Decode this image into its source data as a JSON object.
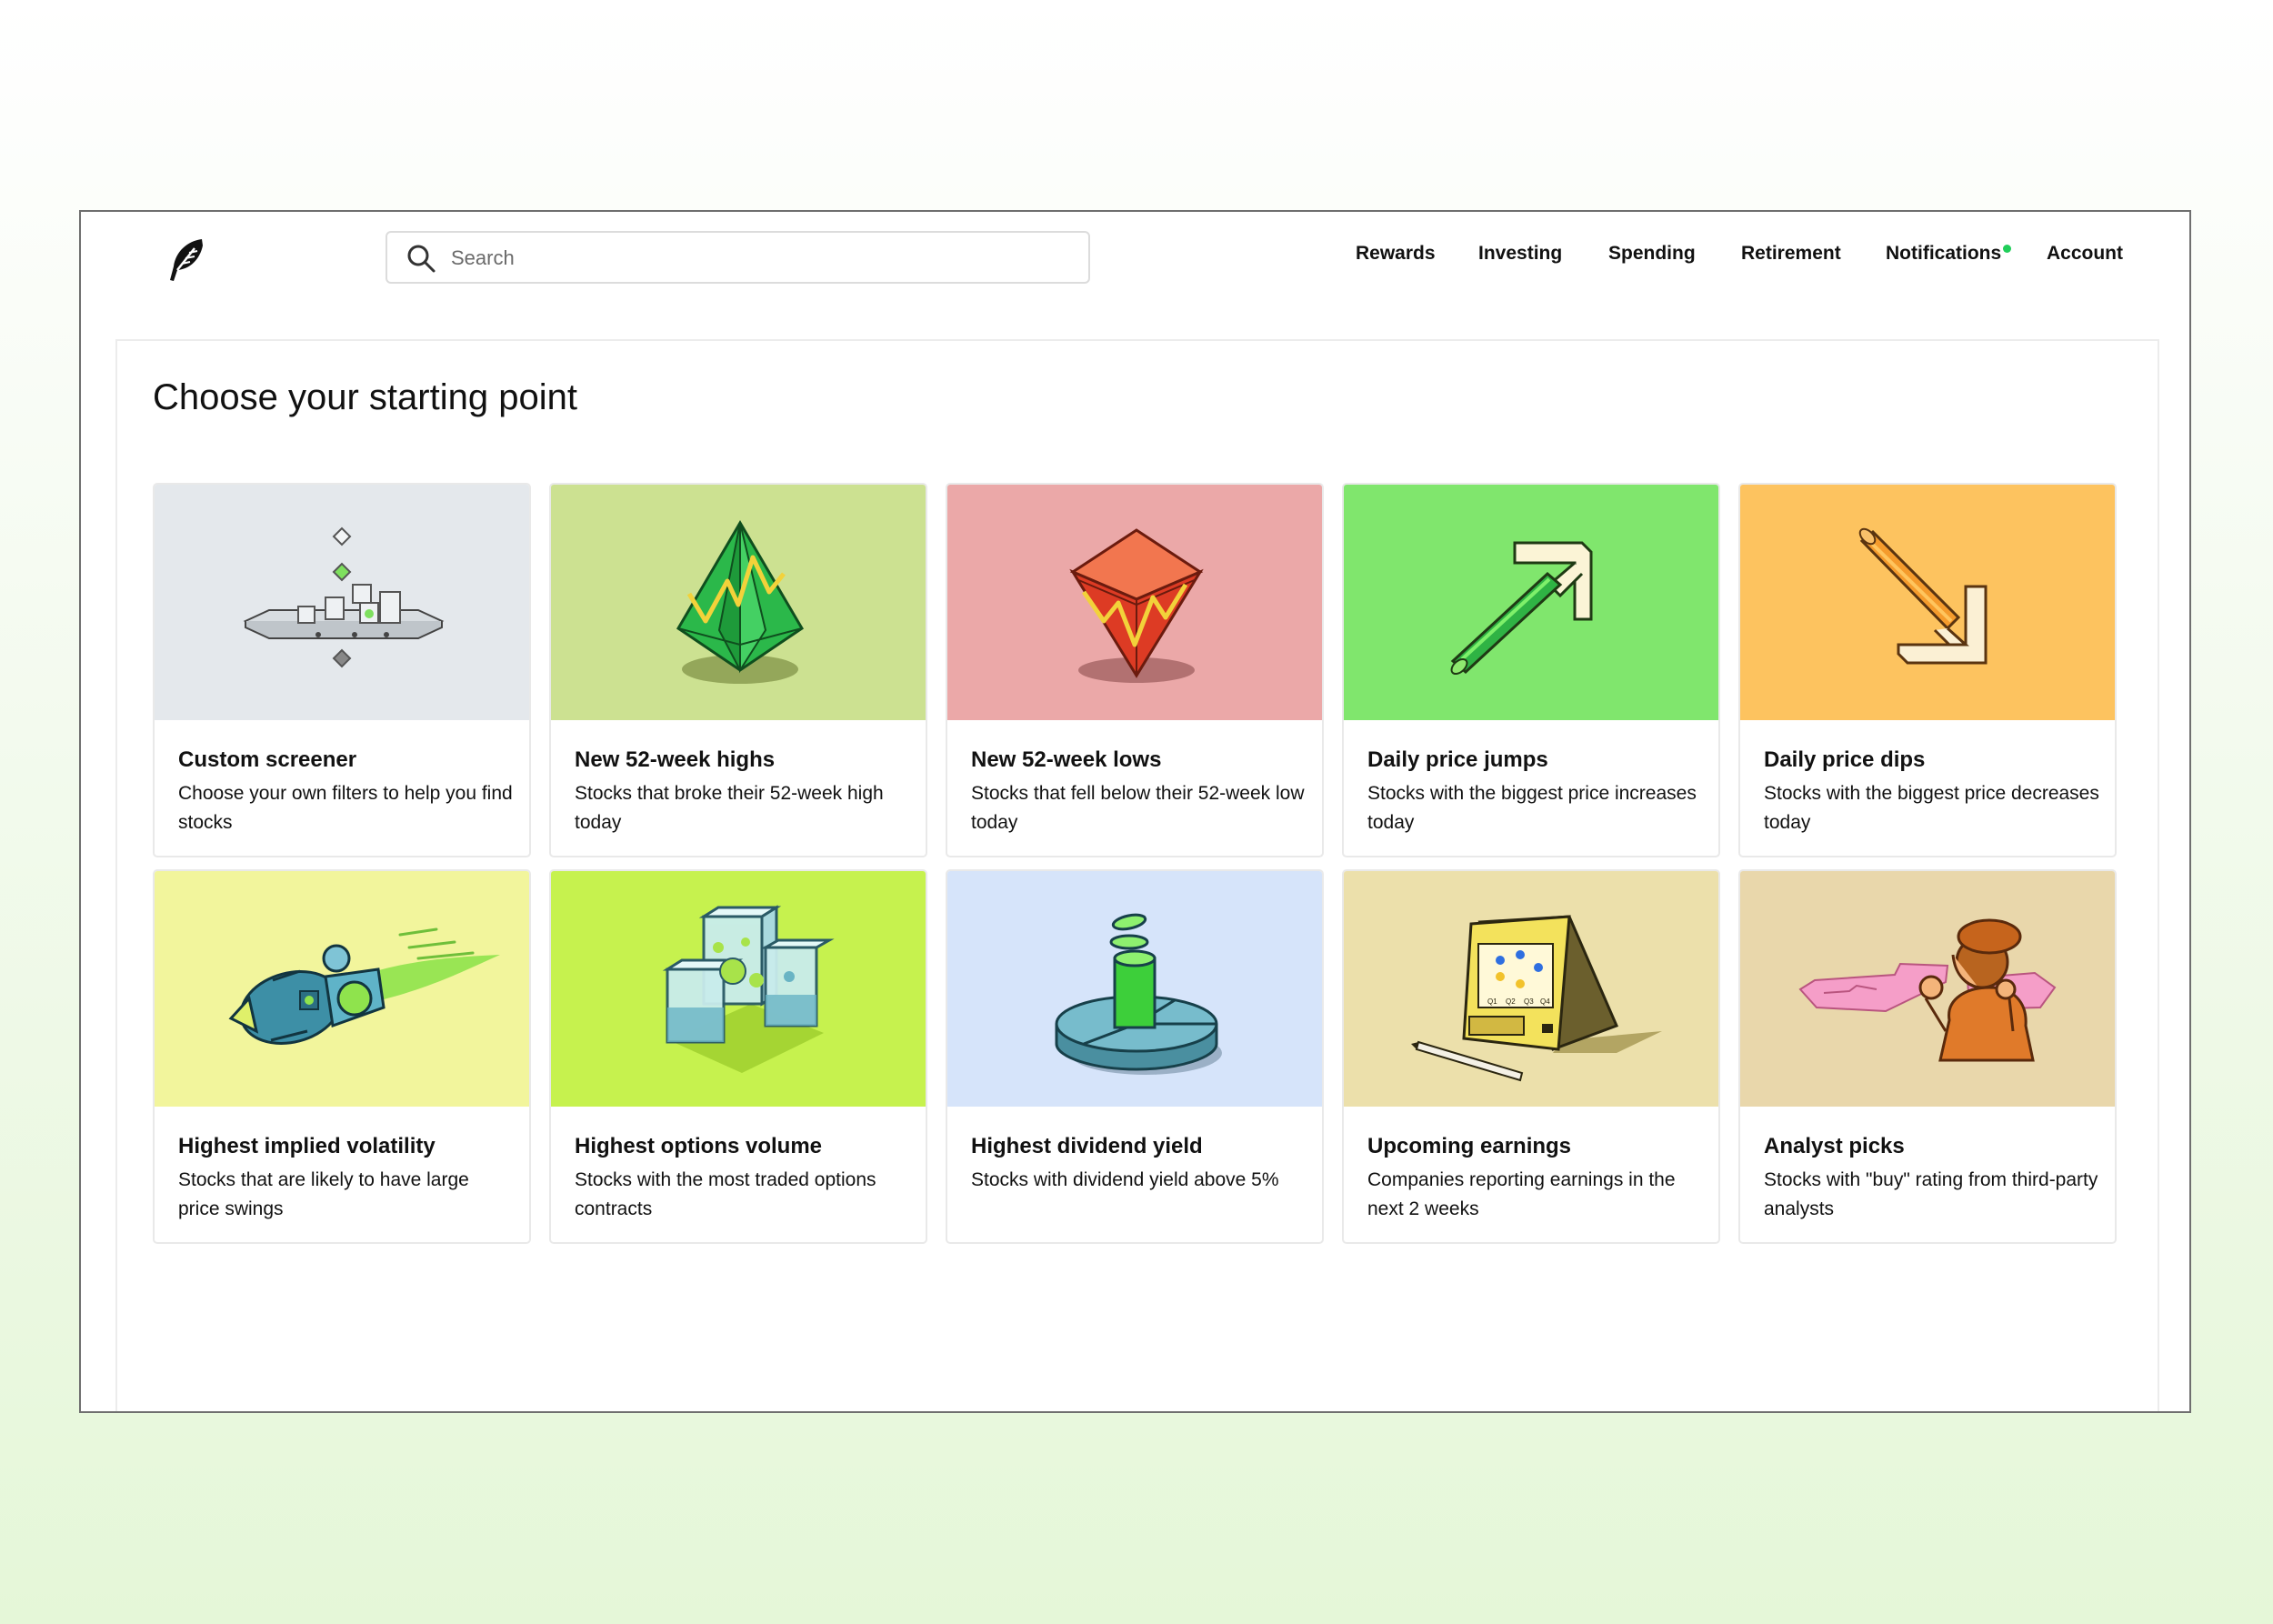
{
  "nav": {
    "search_placeholder": "Search",
    "items": [
      "Rewards",
      "Investing",
      "Spending",
      "Retirement",
      "Notifications",
      "Account"
    ]
  },
  "main": {
    "heading": "Choose your starting point",
    "cards": [
      {
        "title": "Custom screener",
        "description": "Choose your own filters to help you find stocks",
        "background": "#e4e8ec"
      },
      {
        "title": "New 52-week highs",
        "description": "Stocks that broke their 52-week high today",
        "background": "#cce191"
      },
      {
        "title": "New 52-week lows",
        "description": "Stocks that fell below their 52-week low today",
        "background": "#eba8a8"
      },
      {
        "title": "Daily price jumps",
        "description": "Stocks with the biggest price increases today",
        "background": "#80e66d"
      },
      {
        "title": "Daily price dips",
        "description": "Stocks with the biggest price decreases today",
        "background": "#fdc35f"
      },
      {
        "title": "Highest implied volatility",
        "description": "Stocks that are likely to have large price swings",
        "background": "#f2f59c"
      },
      {
        "title": "Highest options volume",
        "description": "Stocks with the most traded options contracts",
        "background": "#c6f24e"
      },
      {
        "title": "Highest dividend yield",
        "description": "Stocks with dividend yield above 5%",
        "background": "#d6e4fa"
      },
      {
        "title": "Upcoming earnings",
        "description": "Companies reporting earnings in the next 2 weeks",
        "background": "#ece0ab"
      },
      {
        "title": "Analyst picks",
        "description": "Stocks with \"buy\" rating from third-party analysts",
        "background": "#e9d7ab"
      }
    ]
  },
  "illustrations": {
    "earnings_chart_labels": [
      "Q1",
      "Q2",
      "Q3",
      "Q4"
    ]
  },
  "colors": {
    "accent_green": "#21ce5a"
  }
}
